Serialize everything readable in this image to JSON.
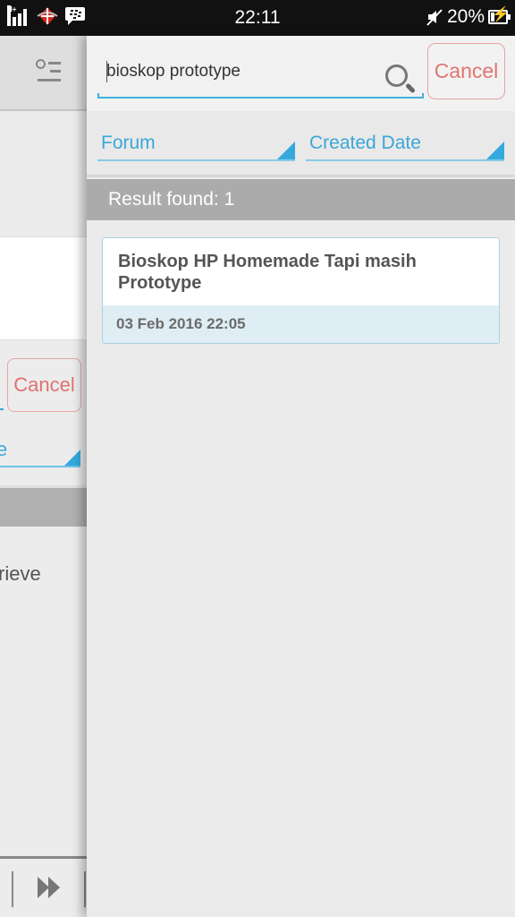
{
  "status_bar": {
    "network_type": "H+",
    "time": "22:11",
    "battery_percent": "20%",
    "battery_level": 0.2,
    "icons": [
      "signal-icon",
      "telkomsel-icon",
      "bbm-icon",
      "mute-icon",
      "battery-charging-icon"
    ]
  },
  "background_panel": {
    "cancel_label": "Cancel",
    "dropdown_partial": "e",
    "text_partial": "rieve",
    "menu_icon": "search-menu-icon",
    "nav_icon": "fast-forward-icon"
  },
  "search": {
    "query": "bioskop prototype",
    "search_icon": "search-icon",
    "cancel_label": "Cancel"
  },
  "filters": {
    "forum_label": "Forum",
    "sort_label": "Created Date"
  },
  "results": {
    "summary": "Result found: 1",
    "items": [
      {
        "title": "Bioskop HP Homemade Tapi masih Prototype",
        "date": "03 Feb 2016 22:05"
      }
    ]
  },
  "colors": {
    "accent_blue": "#35a9de",
    "cancel_red": "#e17572",
    "result_bar": "#ababab",
    "date_band": "#dfeef4"
  }
}
